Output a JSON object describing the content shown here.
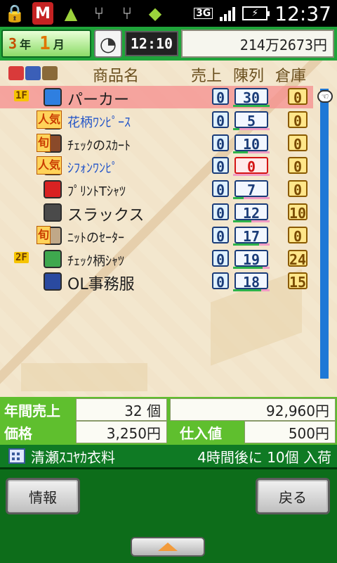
{
  "status_bar": {
    "icons": [
      "lock-icon",
      "mcafee-icon",
      "android-icon",
      "usb-icon",
      "usb-icon",
      "android-icon"
    ],
    "network": "3G",
    "time": "12:37"
  },
  "header": {
    "year_num": "3",
    "year_unit": "年",
    "month_num": "1",
    "month_unit": "月",
    "game_time": "12:10",
    "money": "214万2673円"
  },
  "columns": {
    "name": "商品名",
    "sales": "売上",
    "display": "陳列",
    "stock": "倉庫"
  },
  "rows": [
    {
      "floor": "1F",
      "badge": "",
      "name": "パーカー",
      "small": false,
      "blue": false,
      "sales": "0",
      "display": "30",
      "stock": "0",
      "icon_color": "#2f7fe0",
      "display_red": false,
      "selected": true
    },
    {
      "floor": "",
      "badge": "人気",
      "name": "花柄ﾜﾝﾋﾟｰｽ",
      "small": true,
      "blue": true,
      "sales": "0",
      "display": "5",
      "stock": "0",
      "icon_color": "#e24848",
      "display_red": false,
      "selected": false
    },
    {
      "floor": "",
      "badge": "旬",
      "name": "ﾁｪｯｸのｽｶｰﾄ",
      "small": true,
      "blue": false,
      "sales": "0",
      "display": "10",
      "stock": "0",
      "icon_color": "#8a4a2a",
      "display_red": false,
      "selected": false
    },
    {
      "floor": "",
      "badge": "人気",
      "name": "ｼﾌｫﾝﾜﾝﾋﾟ",
      "small": true,
      "blue": true,
      "sales": "0",
      "display": "0",
      "stock": "0",
      "icon_color": "#f5a0c5",
      "display_red": true,
      "selected": false
    },
    {
      "floor": "",
      "badge": "",
      "name": "ﾌﾟﾘﾝﾄTｼｬﾂ",
      "small": true,
      "blue": false,
      "sales": "0",
      "display": "7",
      "stock": "0",
      "icon_color": "#d92222",
      "display_red": false,
      "selected": false
    },
    {
      "floor": "",
      "badge": "",
      "name": "スラックス",
      "small": false,
      "blue": false,
      "sales": "0",
      "display": "12",
      "stock": "10",
      "icon_color": "#4a4a4a",
      "display_red": false,
      "selected": false
    },
    {
      "floor": "",
      "badge": "旬",
      "name": "ﾆｯﾄのｾｰﾀｰ",
      "small": true,
      "blue": false,
      "sales": "0",
      "display": "17",
      "stock": "0",
      "icon_color": "#c0a888",
      "display_red": false,
      "selected": false
    },
    {
      "floor": "2F",
      "badge": "",
      "name": "ﾁｪｯｸ柄ｼｬﾂ",
      "small": true,
      "blue": false,
      "sales": "0",
      "display": "19",
      "stock": "24",
      "icon_color": "#3ea84e",
      "display_red": false,
      "selected": false
    },
    {
      "floor": "",
      "badge": "",
      "name": "OL事務服",
      "small": false,
      "blue": false,
      "sales": "0",
      "display": "18",
      "stock": "15",
      "icon_color": "#2a4aa0",
      "display_red": false,
      "selected": false
    }
  ],
  "info": {
    "annual_sales_label": "年間売上",
    "annual_sales_qty": "32 個",
    "annual_sales_amount": "92,960円",
    "price_label": "価格",
    "price_value": "3,250円",
    "cost_label": "仕入値",
    "cost_value": "500円"
  },
  "supplier": {
    "name": "清瀬ｽｺﾔｶ衣料",
    "arrival": "4時間後に 10個 入荷"
  },
  "buttons": {
    "info": "情報",
    "back": "戻る"
  }
}
